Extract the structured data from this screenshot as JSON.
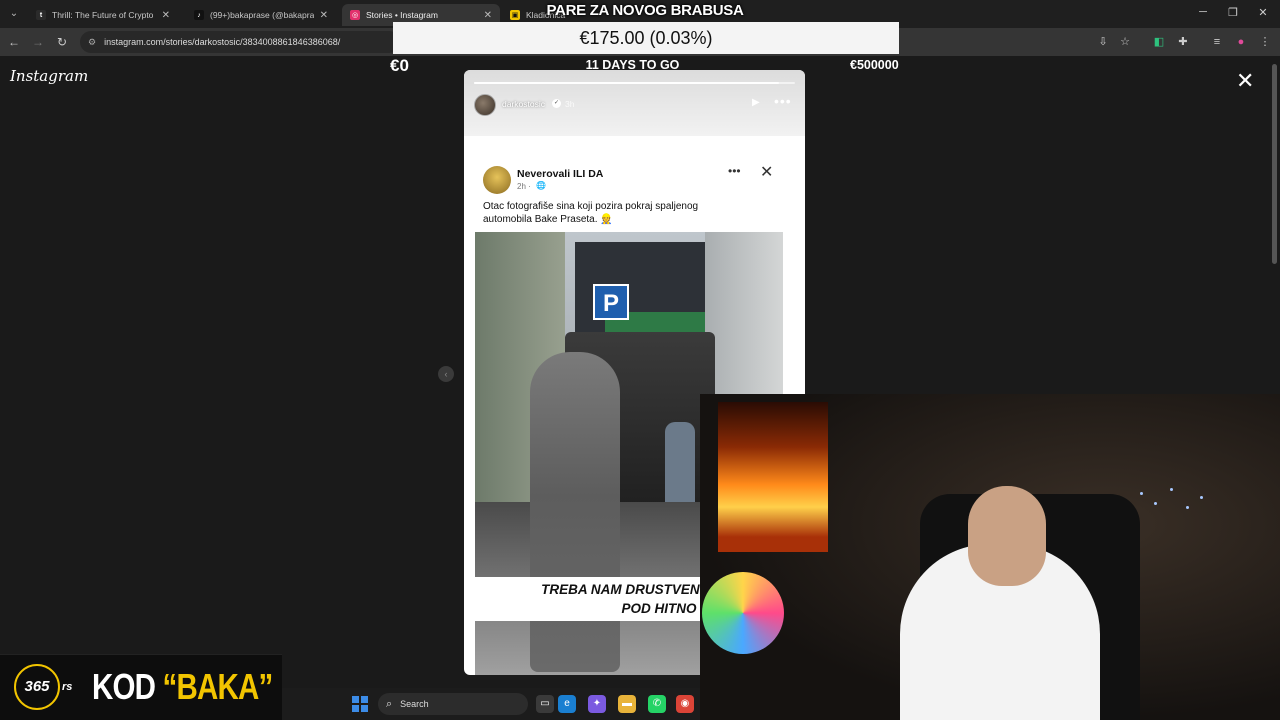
{
  "browser": {
    "tabs": [
      {
        "title": "Thrill: The Future of Crypto Casi",
        "favicon": "t",
        "favicon_color": "#2b2b2b"
      },
      {
        "title": "(99+)bakaprase (@bakaprase) |",
        "favicon": "tiktok",
        "favicon_color": "#111111"
      },
      {
        "title": "Stories • Instagram",
        "favicon": "ig",
        "favicon_color": "#e1306c"
      },
      {
        "title": "Kladionica",
        "favicon": "k",
        "favicon_color": "#f2c500"
      }
    ],
    "active_tab": 2,
    "url": "instagram.com/stories/darkostosic/3834008861846386068/"
  },
  "stream": {
    "goal_title": "PARE ZA NOVOG BRABUSA",
    "goal_amount": "€175.00 (0.03%)",
    "goal_start": "€0",
    "goal_days": "11 DAYS TO GO",
    "goal_end": "€500000",
    "goal_progress_percent": 0.03
  },
  "instagram": {
    "logo": "Instagram",
    "story": {
      "username": "darkostosic",
      "time": "3h",
      "progress_fraction": 0.95
    },
    "post": {
      "page_name": "Neverovali ILI DA",
      "age": "2h ·",
      "text": "Otac fotografiše sina koji pozira pokraj spaljenog automobila Bake Praseta.",
      "emoji": "👷",
      "image_caption_line1": "TREBA NAM DRUSTVENI R",
      "image_caption_line2": "POD HITNO",
      "sign": "P"
    }
  },
  "promo": {
    "logo": "365",
    "suffix": "rs",
    "text_prefix": "KOD ",
    "text_code": "“BAKA”"
  },
  "taskbar": {
    "search_label": "Search"
  }
}
